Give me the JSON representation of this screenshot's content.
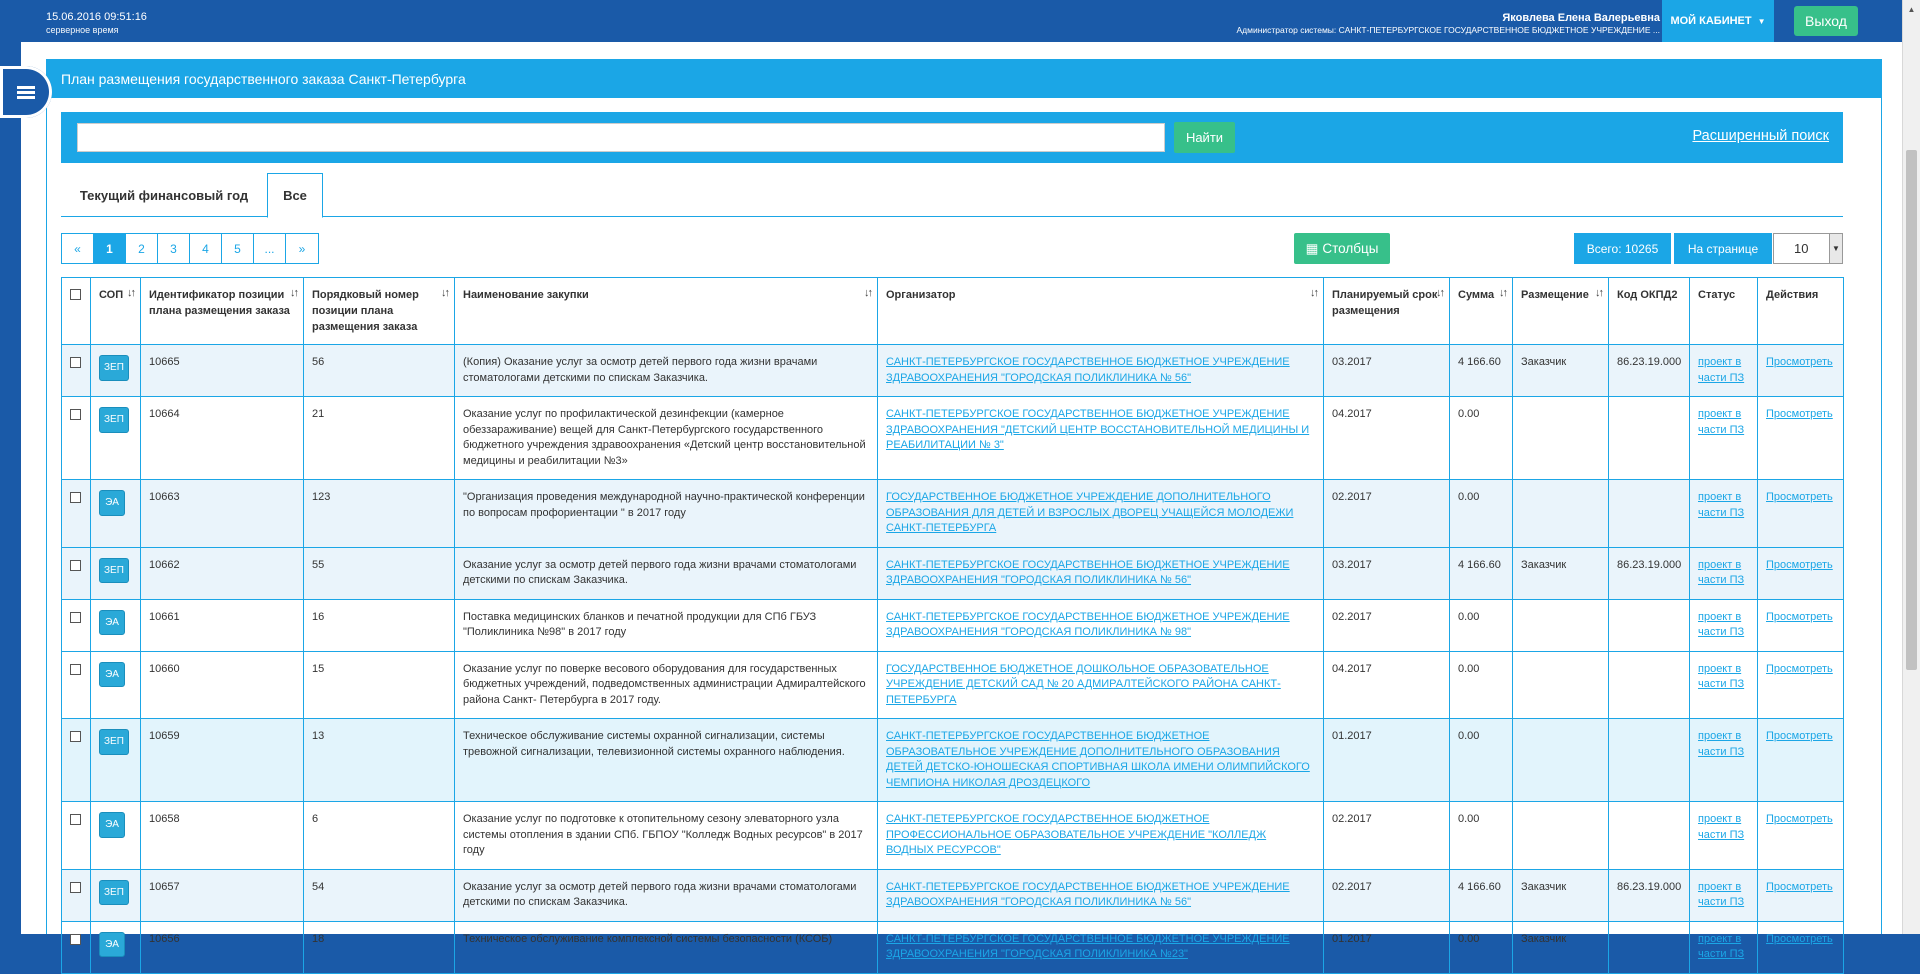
{
  "header": {
    "datetime": "15.06.2016 09:51:16",
    "datetime_caption": "серверное время",
    "user_name": "Яковлева Елена Валерьевна",
    "user_role": "Администратор системы: САНКТ-ПЕТЕРБУРГСКОЕ ГОСУДАРСТВЕННОЕ БЮДЖЕТНОЕ УЧРЕЖДЕНИЕ ...",
    "cabinet_label": "МОЙ КАБИНЕТ",
    "exit_label": "Выход"
  },
  "panel": {
    "title": "План размещения государственного заказа Санкт-Петербурга"
  },
  "search": {
    "value": "",
    "button": "Найти",
    "advanced": "Расширенный поиск"
  },
  "tabs": [
    "Текущий финансовый год",
    "Все"
  ],
  "pager": [
    "«",
    "1",
    "2",
    "3",
    "4",
    "5",
    "...",
    "»"
  ],
  "toolbar": {
    "columns": "Столбцы",
    "total": "Всего: 10265",
    "per_page_label": "На странице",
    "per_page_value": "10"
  },
  "columns": [
    "СОП",
    "Идентификатор позиции плана размещения заказа",
    "Порядковый номер позиции плана размещения заказа",
    "Наименование закупки",
    "Организатор",
    "Планируемый срок размещения",
    "Сумма",
    "Размещение",
    "Код ОКПД2",
    "Статус",
    "Действия"
  ],
  "rows": [
    {
      "sop": "ЗЕП",
      "id": "10665",
      "num": "56",
      "name": "(Копия) Оказание услуг за осмотр детей первого года жизни врачами стоматологами детскими по спискам Заказчика.",
      "org": "САНКТ-ПЕТЕРБУРГСКОЕ ГОСУДАРСТВЕННОЕ БЮДЖЕТНОЕ УЧРЕЖДЕНИЕ ЗДРАВООХРАНЕНИЯ \"ГОРОДСКАЯ ПОЛИКЛИНИКА № 56\"",
      "date": "03.2017",
      "sum": "4 166.60",
      "place": "Заказчик",
      "okpd": "86.23.19.000",
      "status": "проект в части ПЗ",
      "action": "Просмотреть"
    },
    {
      "sop": "ЗЕП",
      "id": "10664",
      "num": "21",
      "name": "Оказание услуг по профилактической дезинфекции (камерное обеззараживание) вещей для Санкт-Петербургского государственного бюджетного учреждения здравоохранения «Детский центр восстановительной медицины и реабилитации №3»",
      "org": "САНКТ-ПЕТЕРБУРГСКОЕ ГОСУДАРСТВЕННОЕ БЮДЖЕТНОЕ УЧРЕЖДЕНИЕ ЗДРАВООХРАНЕНИЯ \"ДЕТСКИЙ ЦЕНТР ВОССТАНОВИТЕЛЬНОЙ МЕДИЦИНЫ И РЕАБИЛИТАЦИИ № 3\"",
      "date": "04.2017",
      "sum": "0.00",
      "place": "",
      "okpd": "",
      "status": "проект в части ПЗ",
      "action": "Просмотреть"
    },
    {
      "sop": "ЭА",
      "id": "10663",
      "num": "123",
      "name": "\"Организация проведения международной научно-практической конференции по вопросам профориентации \" в 2017 году",
      "org": "ГОСУДАРСТВЕННОЕ БЮДЖЕТНОЕ УЧРЕЖДЕНИЕ ДОПОЛНИТЕЛЬНОГО ОБРАЗОВАНИЯ ДЛЯ ДЕТЕЙ И ВЗРОСЛЫХ ДВОРЕЦ УЧАЩЕЙСЯ МОЛОДЕЖИ САНКТ-ПЕТЕРБУРГА",
      "date": "02.2017",
      "sum": "0.00",
      "place": "",
      "okpd": "",
      "status": "проект в части ПЗ",
      "action": "Просмотреть"
    },
    {
      "sop": "ЗЕП",
      "id": "10662",
      "num": "55",
      "name": "Оказание услуг за осмотр детей первого года жизни врачами стоматологами детскими по спискам Заказчика.",
      "org": "САНКТ-ПЕТЕРБУРГСКОЕ ГОСУДАРСТВЕННОЕ БЮДЖЕТНОЕ УЧРЕЖДЕНИЕ ЗДРАВООХРАНЕНИЯ \"ГОРОДСКАЯ ПОЛИКЛИНИКА № 56\"",
      "date": "03.2017",
      "sum": "4 166.60",
      "place": "Заказчик",
      "okpd": "86.23.19.000",
      "status": "проект в части ПЗ",
      "action": "Просмотреть"
    },
    {
      "sop": "ЭА",
      "id": "10661",
      "num": "16",
      "name": "Поставка медицинских бланков и печатной продукции для СПб ГБУЗ \"Поликлиника №98\" в 2017 году",
      "org": "САНКТ-ПЕТЕРБУРГСКОЕ ГОСУДАРСТВЕННОЕ БЮДЖЕТНОЕ УЧРЕЖДЕНИЕ ЗДРАВООХРАНЕНИЯ \"ГОРОДСКАЯ ПОЛИКЛИНИКА № 98\"",
      "date": "02.2017",
      "sum": "0.00",
      "place": "",
      "okpd": "",
      "status": "проект в части ПЗ",
      "action": "Просмотреть"
    },
    {
      "sop": "ЭА",
      "id": "10660",
      "num": "15",
      "name": "Оказание услуг по поверке весового оборудования для государственных бюджетных учреждений, подведомственных администрации Адмиралтейского района Санкт- Петербурга в 2017 году.",
      "org": "ГОСУДАРСТВЕННОЕ БЮДЖЕТНОЕ ДОШКОЛЬНОЕ ОБРАЗОВАТЕЛЬНОЕ УЧРЕЖДЕНИЕ ДЕТСКИЙ САД № 20 АДМИРАЛТЕЙСКОГО РАЙОНА САНКТ-ПЕТЕРБУРГА",
      "date": "04.2017",
      "sum": "0.00",
      "place": "",
      "okpd": "",
      "status": "проект в части ПЗ",
      "action": "Просмотреть"
    },
    {
      "sop": "ЗЕП",
      "id": "10659",
      "num": "13",
      "name": "Техническое обслуживание системы охранной сигнализации, системы тревожной сигнализации, телевизионной системы охранного наблюдения.",
      "org": "САНКТ-ПЕТЕРБУРГСКОЕ ГОСУДАРСТВЕННОЕ БЮДЖЕТНОЕ ОБРАЗОВАТЕЛЬНОЕ УЧРЕЖДЕНИЕ ДОПОЛНИТЕЛЬНОГО ОБРАЗОВАНИЯ ДЕТЕЙ ДЕТСКО-ЮНОШЕСКАЯ СПОРТИВНАЯ ШКОЛА ИМЕНИ ОЛИМПИЙСКОГО ЧЕМПИОНА НИКОЛАЯ ДРОЗДЕЦКОГО",
      "date": "01.2017",
      "sum": "0.00",
      "place": "",
      "okpd": "",
      "status": "проект в части ПЗ",
      "action": "Просмотреть"
    },
    {
      "sop": "ЭА",
      "id": "10658",
      "num": "6",
      "name": "Оказание услуг по подготовке к отопительному сезону элеваторного узла системы отопления в здании СПб. ГБПОУ \"Колледж Водных ресурсов\" в 2017 году",
      "org": "САНКТ-ПЕТЕРБУРГСКОЕ ГОСУДАРСТВЕННОЕ БЮДЖЕТНОЕ ПРОФЕССИОНАЛЬНОЕ ОБРАЗОВАТЕЛЬНОЕ УЧРЕЖДЕНИЕ \"КОЛЛЕДЖ ВОДНЫХ РЕСУРСОВ\"",
      "date": "02.2017",
      "sum": "0.00",
      "place": "",
      "okpd": "",
      "status": "проект в части ПЗ",
      "action": "Просмотреть"
    },
    {
      "sop": "ЗЕП",
      "id": "10657",
      "num": "54",
      "name": "Оказание услуг за осмотр детей первого года жизни врачами стоматологами детскими по спискам Заказчика.",
      "org": "САНКТ-ПЕТЕРБУРГСКОЕ ГОСУДАРСТВЕННОЕ БЮДЖЕТНОЕ УЧРЕЖДЕНИЕ ЗДРАВООХРАНЕНИЯ \"ГОРОДСКАЯ ПОЛИКЛИНИКА № 56\"",
      "date": "02.2017",
      "sum": "4 166.60",
      "place": "Заказчик",
      "okpd": "86.23.19.000",
      "status": "проект в части ПЗ",
      "action": "Просмотреть"
    },
    {
      "sop": "ЭА",
      "id": "10656",
      "num": "18",
      "name": "Техническое обслуживание комплексной системы безопасности (КСОБ)",
      "org": "САНКТ-ПЕТЕРБУРГСКОЕ ГОСУДАРСТВЕННОЕ БЮДЖЕТНОЕ УЧРЕЖДЕНИЕ ЗДРАВООХРАНЕНИЯ \"ГОРОДСКАЯ ПОЛИКЛИНИКА №23\"",
      "date": "01.2017",
      "sum": "0.00",
      "place": "Заказчик",
      "okpd": "",
      "status": "проект в части ПЗ",
      "action": "Просмотреть"
    }
  ]
}
